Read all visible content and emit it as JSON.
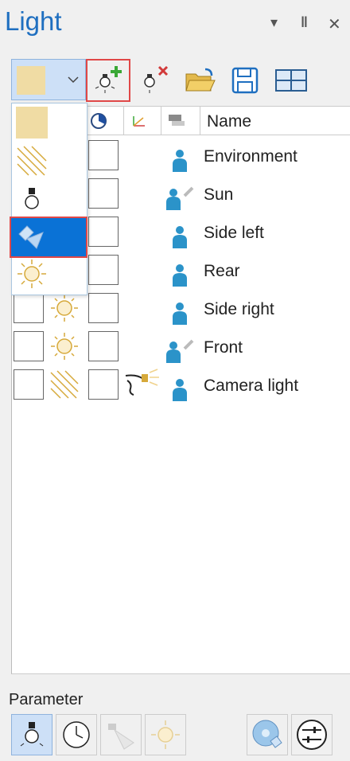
{
  "title": "Light",
  "title_controls": {
    "menu": "▾",
    "pin": "‖",
    "close": "✕"
  },
  "table": {
    "name_header": "Name",
    "rows": [
      {
        "name": "Environment",
        "type": "ambient",
        "on": false
      },
      {
        "name": "Sun",
        "type": "sun",
        "on": false
      },
      {
        "name": "Side left",
        "type": "point",
        "on": false
      },
      {
        "name": "Rear",
        "type": "point",
        "on": false
      },
      {
        "name": "Side right",
        "type": "point",
        "on": false
      },
      {
        "name": "Front",
        "type": "sun",
        "on": false
      },
      {
        "name": "Camera light",
        "type": "spot",
        "on": false
      }
    ]
  },
  "dropdown": {
    "options": [
      "ambient-light",
      "directional-light",
      "point-light",
      "spot-light",
      "sun-light"
    ],
    "selected": "spot-light"
  },
  "parameter": {
    "label": "Parameter"
  },
  "colors": {
    "title": "#1f6fc0",
    "highlight": "#e04848",
    "selected": "#0a72d6",
    "ambient": "#f0dca4"
  }
}
